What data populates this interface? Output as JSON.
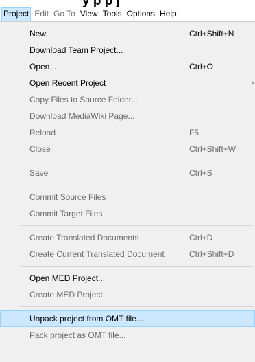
{
  "menubar": {
    "items": [
      {
        "label": "Project",
        "state": "active"
      },
      {
        "label": "Edit",
        "state": "disabled"
      },
      {
        "label": "Go To",
        "state": "disabled"
      },
      {
        "label": "View",
        "state": "normal"
      },
      {
        "label": "Tools",
        "state": "normal"
      },
      {
        "label": "Options",
        "state": "normal"
      },
      {
        "label": "Help",
        "state": "normal"
      }
    ]
  },
  "dropdown": {
    "items": [
      {
        "label": "New...",
        "shortcut": "Ctrl+Shift+N",
        "enabled": true
      },
      {
        "label": "Download Team Project...",
        "shortcut": "",
        "enabled": true
      },
      {
        "label": "Open...",
        "shortcut": "Ctrl+O",
        "enabled": true
      },
      {
        "label": "Open Recent Project",
        "shortcut": "",
        "enabled": true,
        "submenu": true
      },
      {
        "label": "Copy Files to Source Folder...",
        "shortcut": "",
        "enabled": false
      },
      {
        "label": "Download MediaWiki Page...",
        "shortcut": "",
        "enabled": false
      },
      {
        "label": "Reload",
        "shortcut": "F5",
        "enabled": false
      },
      {
        "label": "Close",
        "shortcut": "Ctrl+Shift+W",
        "enabled": false
      },
      {
        "label": "Save",
        "shortcut": "Ctrl+S",
        "enabled": false
      },
      {
        "label": "Commit Source Files",
        "shortcut": "",
        "enabled": false
      },
      {
        "label": "Commit Target Files",
        "shortcut": "",
        "enabled": false
      },
      {
        "label": "Create Translated Documents",
        "shortcut": "Ctrl+D",
        "enabled": false
      },
      {
        "label": "Create Current Translated Document",
        "shortcut": "Ctrl+Shift+D",
        "enabled": false
      },
      {
        "label": "Open MED Project...",
        "shortcut": "",
        "enabled": true
      },
      {
        "label": "Create MED Project...",
        "shortcut": "",
        "enabled": false
      },
      {
        "label": "Unpack project from OMT file...",
        "shortcut": "",
        "enabled": true,
        "highlighted": true
      },
      {
        "label": "Pack project as OMT file...",
        "shortcut": "",
        "enabled": false
      }
    ]
  }
}
